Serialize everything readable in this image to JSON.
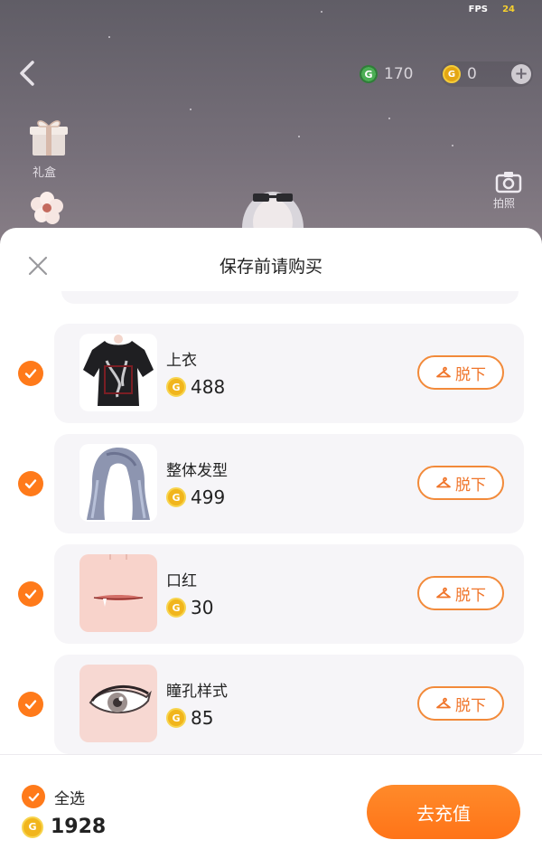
{
  "status": {
    "fps_label": "FPS",
    "fps_value": "24"
  },
  "top_bar": {
    "green_currency_amount": "170",
    "green_currency_icon": "G",
    "gold_currency_amount": "0",
    "gold_currency_icon": "G",
    "add_label": "+"
  },
  "scene": {
    "gift_label": "礼盒",
    "camera_label": "拍照"
  },
  "sheet": {
    "title": "保存前请购买",
    "items": [
      {
        "name": "上衣",
        "price": "488",
        "action": "脱下",
        "icon": "tshirt-icon",
        "checked": true
      },
      {
        "name": "整体发型",
        "price": "499",
        "action": "脱下",
        "icon": "hair-icon",
        "checked": true
      },
      {
        "name": "口红",
        "price": "30",
        "action": "脱下",
        "icon": "lips-icon",
        "checked": true
      },
      {
        "name": "瞳孔样式",
        "price": "85",
        "action": "脱下",
        "icon": "eye-icon",
        "checked": true
      }
    ]
  },
  "footer": {
    "select_all_label": "全选",
    "total_price": "1928",
    "recharge_label": "去充值"
  },
  "colors": {
    "accent": "#ff7a1a",
    "coin": "#f1b51c",
    "card_bg": "#f6f5f8"
  }
}
